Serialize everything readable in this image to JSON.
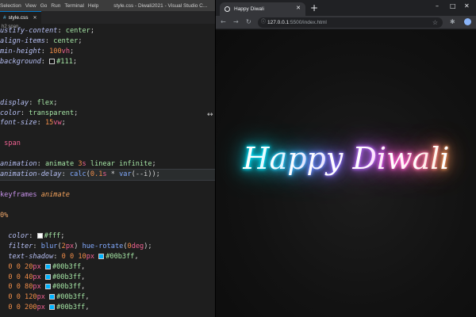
{
  "vscode": {
    "menu": [
      "Selection",
      "View",
      "Go",
      "Run",
      "Terminal",
      "Help"
    ],
    "window_title": "style.css - Diwali2021 - Visual Studio C...",
    "tab": {
      "label": "style.css",
      "icon": "css-hash-icon"
    },
    "breadcrumb": "h2 span",
    "colors": {
      "accent": "#007acc",
      "editor_bg": "#1e1e1e"
    }
  },
  "code_lines": [
    [
      [
        "p",
        "ustify-content"
      ],
      [
        "w",
        ": "
      ],
      [
        "v",
        "center"
      ],
      [
        "w",
        ";"
      ]
    ],
    [
      [
        "p",
        "align-items"
      ],
      [
        "w",
        ": "
      ],
      [
        "v",
        "center"
      ],
      [
        "w",
        ";"
      ]
    ],
    [
      [
        "p",
        "min-height"
      ],
      [
        "w",
        ": "
      ],
      [
        "n",
        "100"
      ],
      [
        "u",
        "vh"
      ],
      [
        "w",
        ";"
      ]
    ],
    [
      [
        "p",
        "background"
      ],
      [
        "w",
        ": "
      ],
      [
        "sw",
        "#111111"
      ],
      [
        "v",
        "#111"
      ],
      [
        "w",
        ";"
      ]
    ],
    [],
    [],
    [],
    [
      [
        "p",
        "display"
      ],
      [
        "w",
        ": "
      ],
      [
        "v",
        "flex"
      ],
      [
        "w",
        ";"
      ]
    ],
    [
      [
        "p",
        "color"
      ],
      [
        "w",
        ": "
      ],
      [
        "v",
        "transparent"
      ],
      [
        "w",
        ";"
      ]
    ],
    [
      [
        "p",
        "font-size"
      ],
      [
        "w",
        ": "
      ],
      [
        "n",
        "15"
      ],
      [
        "u",
        "vw"
      ],
      [
        "w",
        ";"
      ]
    ],
    [],
    [
      [
        "s",
        " span"
      ]
    ],
    [],
    [
      [
        "p",
        "animation"
      ],
      [
        "w",
        ": "
      ],
      [
        "v",
        "animate "
      ],
      [
        "n",
        "3"
      ],
      [
        "u",
        "s"
      ],
      [
        "v",
        " linear infinite"
      ],
      [
        "w",
        ";"
      ]
    ],
    [
      [
        "p",
        "animation-delay"
      ],
      [
        "w",
        ": "
      ],
      [
        "fn",
        "calc"
      ],
      [
        "w",
        "("
      ],
      [
        "n",
        "0.1"
      ],
      [
        "u",
        "s"
      ],
      [
        "w",
        " * "
      ],
      [
        "fn",
        "var"
      ],
      [
        "w",
        "(--i));"
      ]
    ],
    [],
    [
      [
        "at",
        "keyframes "
      ],
      [
        "it",
        "animate"
      ]
    ],
    [],
    [
      [
        "k",
        "0%"
      ]
    ],
    [],
    [
      [
        "w",
        "  "
      ],
      [
        "p",
        "color"
      ],
      [
        "w",
        ": "
      ],
      [
        "sw",
        "#ffffff"
      ],
      [
        "v",
        "#fff"
      ],
      [
        "w",
        ";"
      ]
    ],
    [
      [
        "w",
        "  "
      ],
      [
        "p",
        "filter"
      ],
      [
        "w",
        ": "
      ],
      [
        "fn",
        "blur"
      ],
      [
        "w",
        "("
      ],
      [
        "n",
        "2"
      ],
      [
        "u",
        "px"
      ],
      [
        "w",
        ") "
      ],
      [
        "fn",
        "hue-rotate"
      ],
      [
        "w",
        "("
      ],
      [
        "n",
        "0"
      ],
      [
        "u",
        "deg"
      ],
      [
        "w",
        ");"
      ]
    ],
    [
      [
        "w",
        "  "
      ],
      [
        "p",
        "text-shadow"
      ],
      [
        "w",
        ": "
      ],
      [
        "n",
        "0 0 10"
      ],
      [
        "u",
        "px"
      ],
      [
        "w",
        " "
      ],
      [
        "sw",
        "#00b3ff"
      ],
      [
        "v",
        "#00b3ff"
      ],
      [
        "w",
        ","
      ]
    ],
    [
      [
        "w",
        "  "
      ],
      [
        "n",
        "0 0 20"
      ],
      [
        "u",
        "px"
      ],
      [
        "w",
        " "
      ],
      [
        "sw",
        "#00b3ff"
      ],
      [
        "v",
        "#00b3ff"
      ],
      [
        "w",
        ","
      ]
    ],
    [
      [
        "w",
        "  "
      ],
      [
        "n",
        "0 0 40"
      ],
      [
        "u",
        "px"
      ],
      [
        "w",
        " "
      ],
      [
        "sw",
        "#00b3ff"
      ],
      [
        "v",
        "#00b3ff"
      ],
      [
        "w",
        ","
      ]
    ],
    [
      [
        "w",
        "  "
      ],
      [
        "n",
        "0 0 80"
      ],
      [
        "u",
        "px"
      ],
      [
        "w",
        " "
      ],
      [
        "sw",
        "#00b3ff"
      ],
      [
        "v",
        "#00b3ff"
      ],
      [
        "w",
        ","
      ]
    ],
    [
      [
        "w",
        "  "
      ],
      [
        "n",
        "0 0 120"
      ],
      [
        "u",
        "px"
      ],
      [
        "w",
        " "
      ],
      [
        "sw",
        "#00b3ff"
      ],
      [
        "v",
        "#00b3ff"
      ],
      [
        "w",
        ","
      ]
    ],
    [
      [
        "w",
        "  "
      ],
      [
        "n",
        "0 0 200"
      ],
      [
        "u",
        "px"
      ],
      [
        "w",
        " "
      ],
      [
        "sw",
        "#00b3ff"
      ],
      [
        "v",
        "#00b3ff"
      ],
      [
        "w",
        ","
      ]
    ]
  ],
  "browser": {
    "tab_title": "Happy Diwali",
    "new_tab": "+",
    "window_controls": [
      "–",
      "□",
      "✕"
    ],
    "url_host": "127.0.0.1",
    "url_path": ":5500/index.html",
    "heading_letters": [
      "H",
      "a",
      "p",
      "p",
      "y",
      " ",
      "D",
      "i",
      "w",
      "a",
      "l",
      "i"
    ],
    "glow_colors": [
      "#00e5ff",
      "#22d3ff",
      "#3fb6ff",
      "#6a8cff",
      "#8a70ff",
      "#ffffff",
      "#b86bff",
      "#e060ff",
      "#ff5fd0",
      "#ff6fa8",
      "#ff7f7f",
      "#ff9a5c"
    ]
  }
}
